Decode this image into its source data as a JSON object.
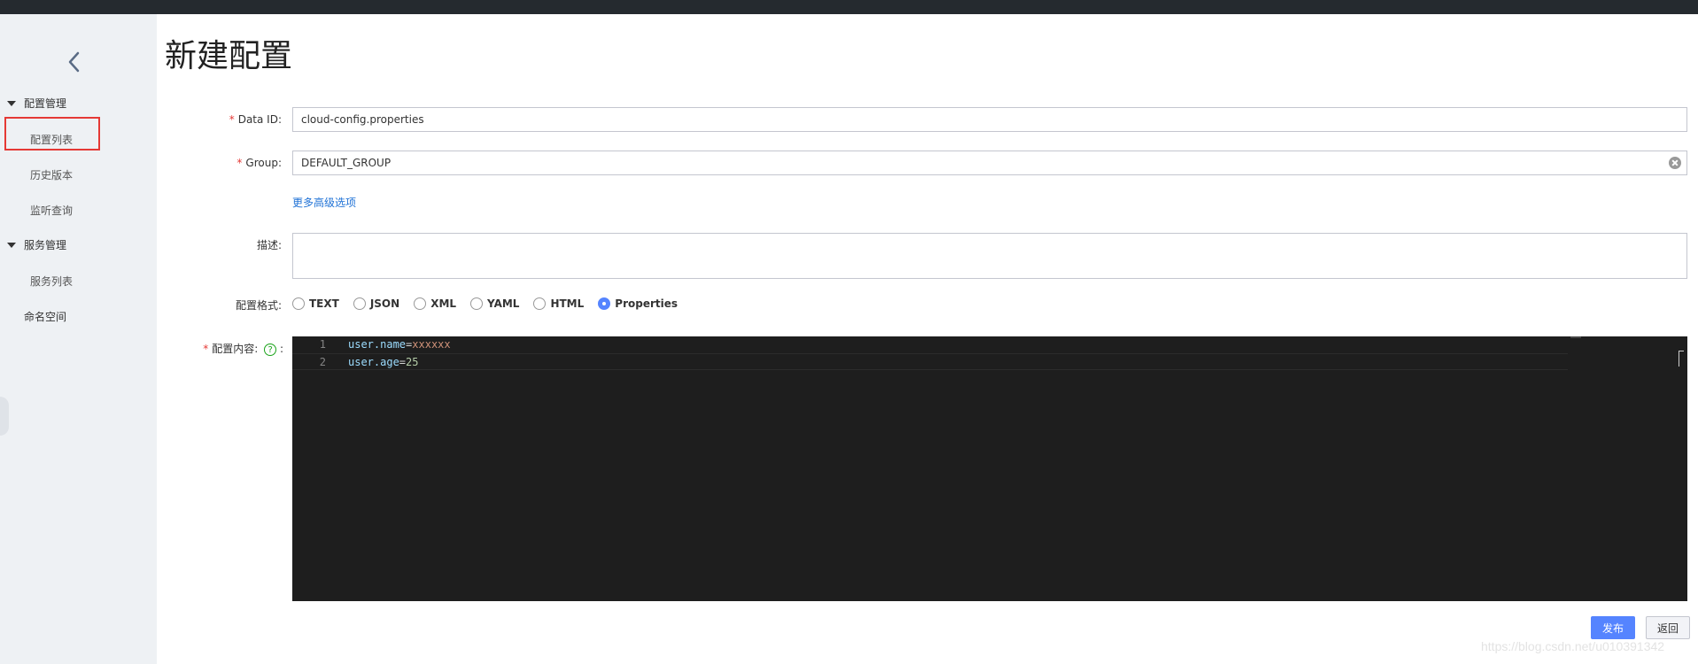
{
  "sidebar": {
    "groups": [
      {
        "label": "配置管理",
        "items": [
          "配置列表",
          "历史版本",
          "监听查询"
        ]
      },
      {
        "label": "服务管理",
        "items": [
          "服务列表"
        ]
      }
    ],
    "top_item": "命名空间",
    "active_item": "配置列表"
  },
  "page": {
    "title": "新建配置"
  },
  "form": {
    "data_id": {
      "label": "Data ID:",
      "value": "cloud-config.properties"
    },
    "group": {
      "label": "Group:",
      "value": "DEFAULT_GROUP"
    },
    "advanced_link": "更多高级选项",
    "description": {
      "label": "描述:",
      "value": ""
    },
    "format": {
      "label": "配置格式:",
      "options": [
        "TEXT",
        "JSON",
        "XML",
        "YAML",
        "HTML",
        "Properties"
      ],
      "selected": "Properties"
    },
    "content": {
      "label": "配置内容:",
      "suffix": ":",
      "lines": [
        {
          "num": "1",
          "key": "user.name",
          "op": "=",
          "value": "xxxxxx",
          "value_type": "string"
        },
        {
          "num": "2",
          "key": "user.age",
          "op": "=",
          "value": "25",
          "value_type": "number"
        }
      ]
    }
  },
  "buttons": {
    "publish": "发布",
    "back": "返回"
  },
  "watermark": "https://blog.csdn.net/u010391342",
  "colors": {
    "primary": "#5584ff",
    "required": "#e53935",
    "link": "#1f72d6",
    "editor_bg": "#1e1e1e"
  }
}
